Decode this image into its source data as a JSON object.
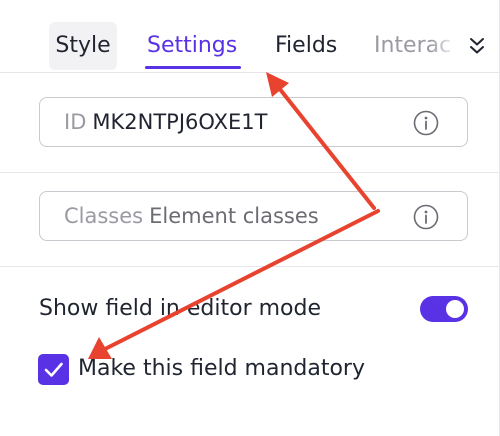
{
  "tabs": {
    "items": [
      "Style",
      "Settings",
      "Fields",
      "Interac"
    ],
    "active": "Settings"
  },
  "id_field": {
    "label": "ID",
    "value": "MK2NTPJ6OXE1T"
  },
  "classes_field": {
    "label": "Classes",
    "placeholder": "Element classes"
  },
  "show_in_editor": {
    "label": "Show field in editor mode",
    "enabled": true
  },
  "mandatory": {
    "label": "Make this field mandatory",
    "checked": true
  },
  "colors": {
    "accent": "#5a32e6",
    "annotation_arrow": "#e8432f"
  },
  "icons": {
    "tabs_more": "chevron-down-icon",
    "field_info": "info-circle-icon",
    "checkbox": "check-icon"
  }
}
